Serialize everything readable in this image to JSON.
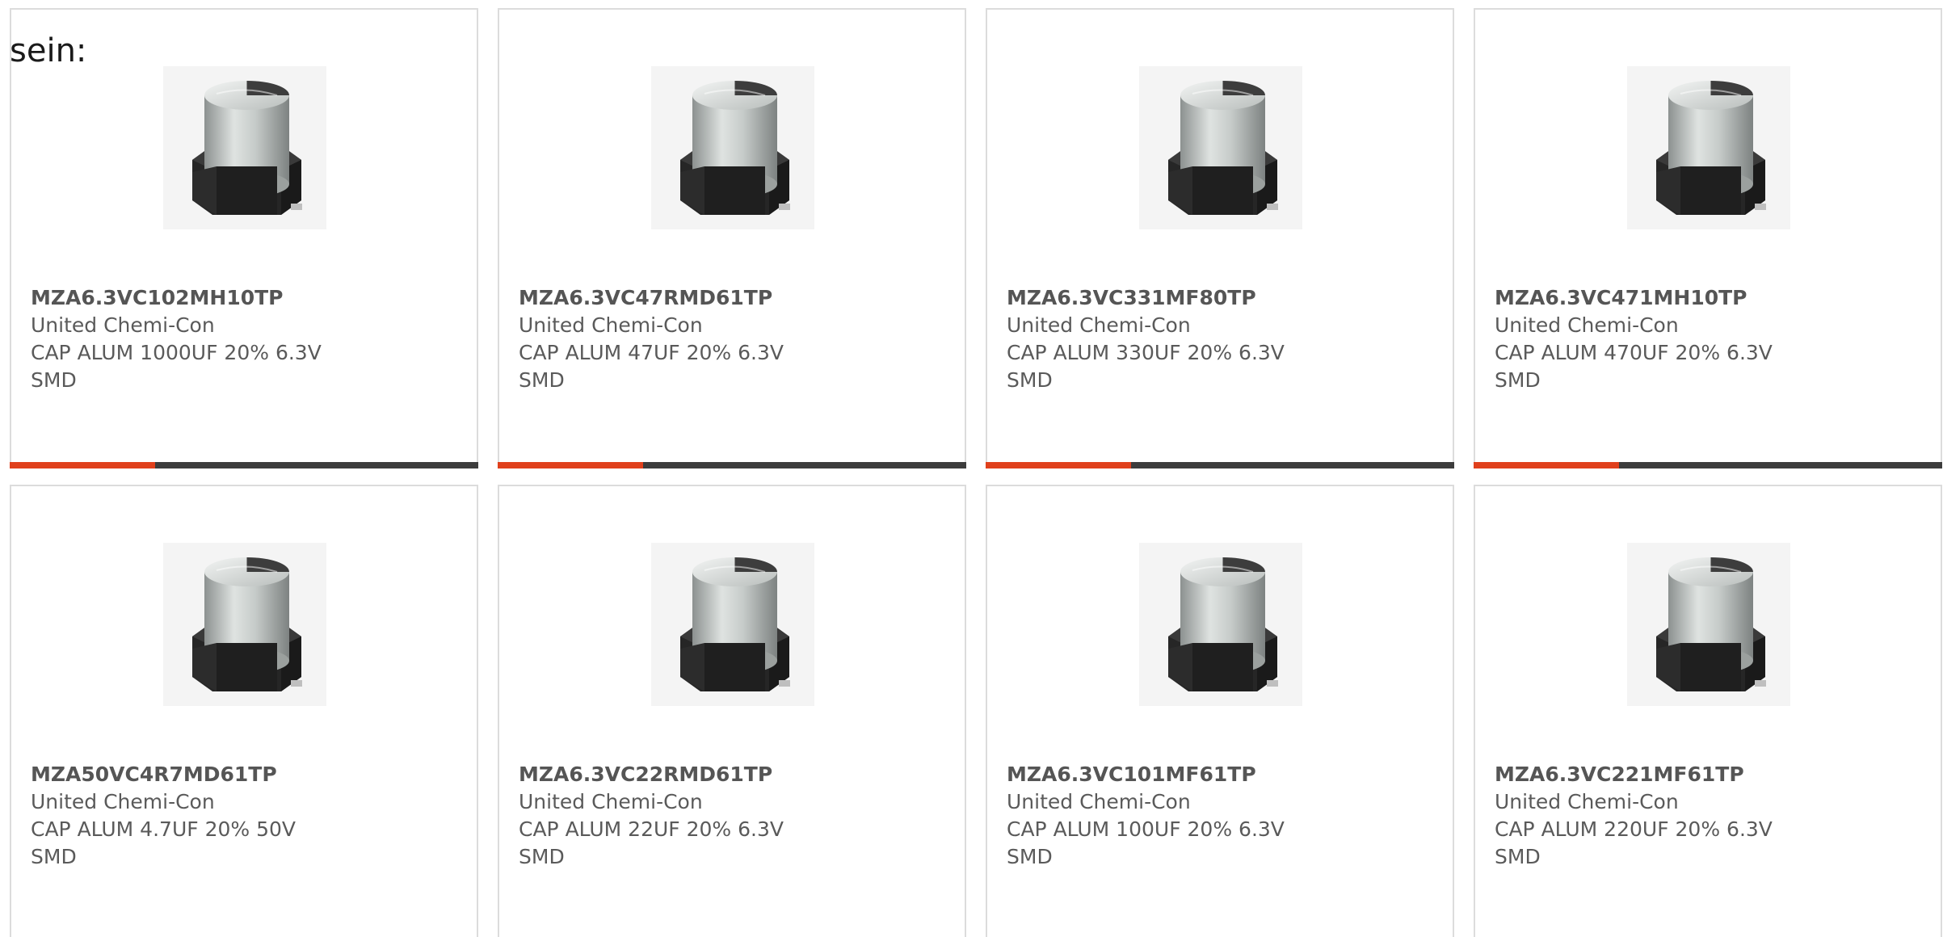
{
  "intro_text": "sein:",
  "colors": {
    "accent_orange": "#e0401c",
    "bar_dark": "#3c3c3c",
    "border": "#dcdcdc"
  },
  "products": [
    {
      "part": "MZA6.3VC102MH10TP",
      "manufacturer": "United Chemi-Con",
      "description": "CAP ALUM 1000UF 20% 6.3V SMD",
      "image_icon": "capacitor-image",
      "progress": 0.31
    },
    {
      "part": "MZA6.3VC47RMD61TP",
      "manufacturer": "United Chemi-Con",
      "description": "CAP ALUM 47UF 20% 6.3V SMD",
      "image_icon": "capacitor-image",
      "progress": 0.31
    },
    {
      "part": "MZA6.3VC331MF80TP",
      "manufacturer": "United Chemi-Con",
      "description": "CAP ALUM 330UF 20% 6.3V SMD",
      "image_icon": "capacitor-image",
      "progress": 0.31
    },
    {
      "part": "MZA6.3VC471MH10TP",
      "manufacturer": "United Chemi-Con",
      "description": "CAP ALUM 470UF 20% 6.3V SMD",
      "image_icon": "capacitor-image",
      "progress": 0.31
    },
    {
      "part": "MZA50VC4R7MD61TP",
      "manufacturer": "United Chemi-Con",
      "description": "CAP ALUM 4.7UF 20% 50V SMD",
      "image_icon": "capacitor-image"
    },
    {
      "part": "MZA6.3VC22RMD61TP",
      "manufacturer": "United Chemi-Con",
      "description": "CAP ALUM 22UF 20% 6.3V SMD",
      "image_icon": "capacitor-image"
    },
    {
      "part": "MZA6.3VC101MF61TP",
      "manufacturer": "United Chemi-Con",
      "description": "CAP ALUM 100UF 20% 6.3V SMD",
      "image_icon": "capacitor-image"
    },
    {
      "part": "MZA6.3VC221MF61TP",
      "manufacturer": "United Chemi-Con",
      "description": "CAP ALUM 220UF 20% 6.3V SMD",
      "image_icon": "capacitor-image"
    }
  ]
}
